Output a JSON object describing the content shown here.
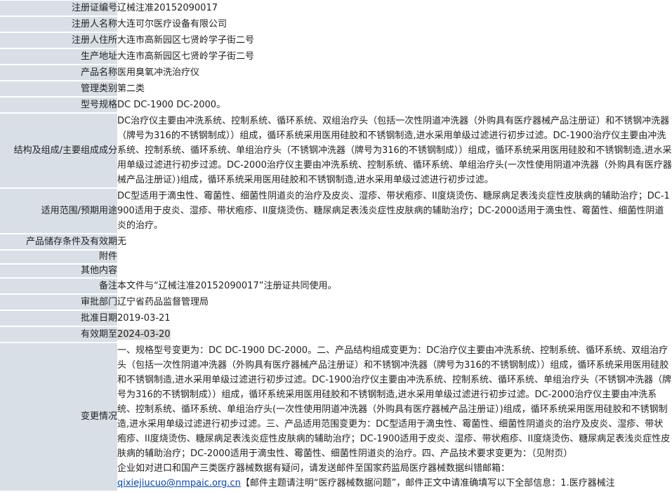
{
  "fields": [
    {
      "label": "注册证编号",
      "value": "辽械注准20152090017"
    },
    {
      "label": "注册人名称",
      "value": "大连可尔医疗设备有限公司"
    },
    {
      "label": "注册人住所",
      "value": "大连市高新园区七贤岭学子街二号"
    },
    {
      "label": "生产地址",
      "value": "大连市高新园区七贤岭学子街二号"
    },
    {
      "label": "产品名称",
      "value": "医用臭氧冲洗治疗仪"
    },
    {
      "label": "管理类别",
      "value": "第二类"
    },
    {
      "label": "型号规格",
      "value": "DC DC-1900 DC-2000。"
    },
    {
      "label": "结构及组成/主要组成成分",
      "value": "DC治疗仪主要由冲洗系统、控制系统、循环系统、双组治疗头（包括一次性阴道冲洗器（外购具有医疗器械产品注册证）和不锈钢冲洗器（牌号为316的不锈钢制成））组成，循环系统采用医用硅胶和不锈钢制造,进水采用单级过滤进行初步过滤。DC-1900治疗仪主要由冲洗系统、控制系统、循环系统、单组治疗头（不锈钢冲洗器（牌号为316的不锈钢制成））组成，循环系统采用医用硅胶和不锈钢制造,进水采用单级过滤进行初步过滤。DC-2000治疗仪主要由冲洗系统、控制系统、循环系统、单组治疗头(一次性使用阴道冲洗器（外购具有医疗器械产品注册证）)组成，循环系统采用医用硅胶和不锈钢制造,进水采用单级过滤进行初步过滤。"
    },
    {
      "label": "适用范围/预期用途",
      "value": "DC型适用于滴虫性、霉菌性、细菌性阴道炎的治疗及皮炎、湿疹、带状疱疹、II度烧烫伤、糖尿病足表浅炎症性皮肤病的辅助治疗；DC-1900适用于皮炎、湿疹、带状疱疹、II度烧烫伤、糖尿病足表浅炎症性皮肤病的辅助治疗；DC-2000适用于滴虫性、霉菌性、细菌性阴道炎的治疗。"
    },
    {
      "label": "产品储存条件及有效期",
      "value": "无"
    },
    {
      "label": "附件",
      "value": ""
    },
    {
      "label": "其他内容",
      "value": ""
    },
    {
      "label": "备注",
      "value": "本文件与“辽械注准20152090017”注册证共同使用。"
    },
    {
      "label": "审批部门",
      "value": "辽宁省药品监督管理局"
    },
    {
      "label": "批准日期",
      "value": "2019-03-21"
    },
    {
      "label": "有效期至",
      "value": "2024-03-20"
    },
    {
      "label": "变更情况",
      "value": "一、规格型号变更为：DC DC-1900 DC-2000。二、产品结构组成变更为：DC治疗仪主要由冲洗系统、控制系统、循环系统、双组治疗头（包括一次性阴道冲洗器（外购具有医疗器械产品注册证）和不锈钢冲洗器（牌号为316的不锈钢制成））组成，循环系统采用医用硅胶和不锈钢制造,进水采用单级过滤进行初步过滤。DC-1900治疗仪主要由冲洗系统、控制系统、循环系统、单组治疗头（不锈钢冲洗器（牌号为316的不锈钢制成））组成，循环系统采用医用硅胶和不锈钢制造,进水采用单级过滤进行初步过滤。DC-2000治疗仪主要由冲洗系统、控制系统、循环系统、单组治疗头(一次性使用阴道冲洗器（外购具有医疗器械产品注册证）)组成，循环系统采用医用硅胶和不锈钢制造,进水采用单级过滤进行初步过滤。三、产品适用范围变更为：DC型适用于滴虫性、霉菌性、细菌性阴道炎的治疗及皮炎、湿疹、带状疱疹、II度烧烫伤、糖尿病足表浅炎症性皮肤病的辅助治疗；DC-1900适用于皮炎、湿疹、带状疱疹、II度烧烫伤、糖尿病足表浅炎症性皮肤病的辅助治疗；DC-2000适用于滴虫性、霉菌性、细菌性阴道炎的治疗。四、产品技术要求变更为：（见附页）"
    }
  ],
  "footer": {
    "line1": "企业如对进口和国产三类医疗器械数据有疑问，请发送邮件至国家药监局医疗器械数据纠错邮箱：",
    "email": "qixiejiucuo@nmpaic.org.cn",
    "line2": "【邮件主题请注明“医疗器械数据问题”，邮件正文中请准确填写以下全部信息：1.医疗器械注"
  }
}
